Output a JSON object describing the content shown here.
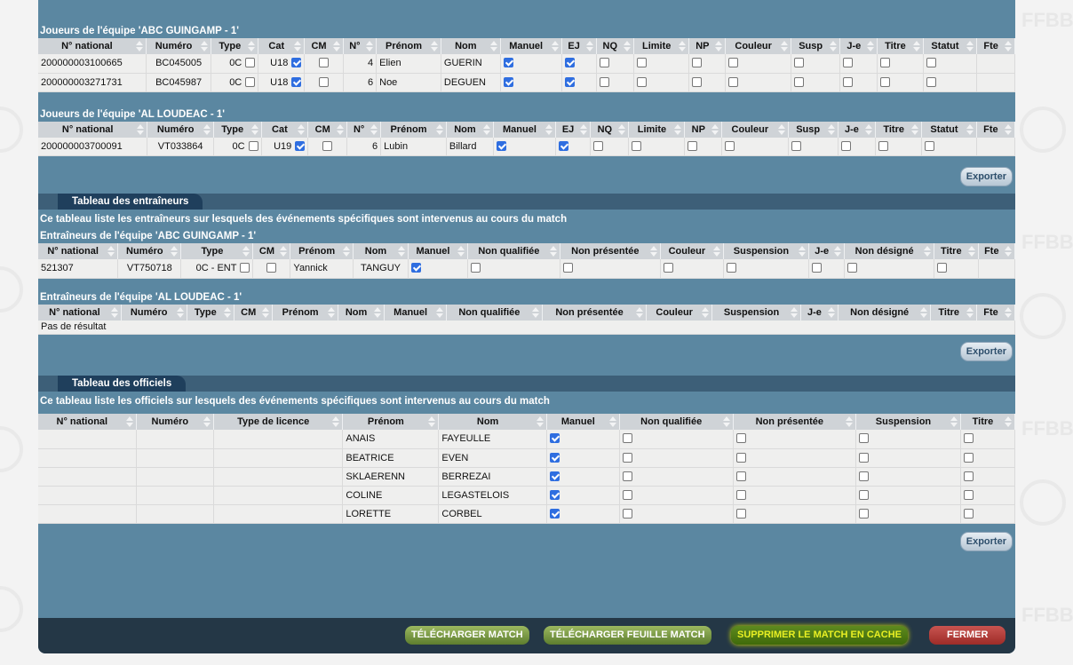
{
  "team_players": [
    {
      "title": "Joueurs de l'équipe 'ABC GUINGAMP - 1'",
      "headers": [
        "N° national",
        "Numéro",
        "Type",
        "Cat",
        "CM",
        "N°",
        "Prénom",
        "Nom",
        "Manuel",
        "EJ",
        "NQ",
        "Limite",
        "NP",
        "Couleur",
        "Susp",
        "J-e",
        "Titre",
        "Statut",
        "Fte"
      ],
      "rows": [
        {
          "national": "200000003100665",
          "numero": "BC045005",
          "type": "0C",
          "cat": "U18",
          "num": "4",
          "prenom": "Elien",
          "nom": "GUERIN"
        },
        {
          "national": "200000003271731",
          "numero": "BC045987",
          "type": "0C",
          "cat": "U18",
          "num": "6",
          "prenom": "Noe",
          "nom": "DEGUEN"
        }
      ]
    },
    {
      "title": "Joueurs de l'équipe 'AL LOUDEAC - 1'",
      "headers": [
        "N° national",
        "Numéro",
        "Type",
        "Cat",
        "CM",
        "N°",
        "Prénom",
        "Nom",
        "Manuel",
        "EJ",
        "NQ",
        "Limite",
        "NP",
        "Couleur",
        "Susp",
        "J-e",
        "Titre",
        "Statut",
        "Fte"
      ],
      "rows": [
        {
          "national": "200000003700091",
          "numero": "VT033864",
          "type": "0C",
          "cat": "U19",
          "num": "6",
          "prenom": "Lubin",
          "nom": "Billard"
        }
      ]
    }
  ],
  "export_label": "Exporter",
  "coaches": {
    "section_title": "Tableau des entraîneurs",
    "description": "Ce tableau liste les entraîneurs sur lesquels des événements spécifiques sont intervenus au cours du match",
    "team1_title": "Entraîneurs de l'équipe 'ABC GUINGAMP - 1'",
    "team1_headers": [
      "N° national",
      "Numéro",
      "Type",
      "CM",
      "Prénom",
      "Nom",
      "Manuel",
      "Non qualifiée",
      "Non présentée",
      "Couleur",
      "Suspension",
      "J-e",
      "Non désigné",
      "Titre",
      "Fte"
    ],
    "team1_row": {
      "national": "521307",
      "numero": "VT750718",
      "type": "0C - ENT",
      "prenom": "Yannick",
      "nom": "TANGUY"
    },
    "team2_title": "Entraîneurs de l'équipe 'AL LOUDEAC - 1'",
    "team2_headers": [
      "N° national",
      "Numéro",
      "Type",
      "CM",
      "Prénom",
      "Nom",
      "Manuel",
      "Non qualifiée",
      "Non présentée",
      "Couleur",
      "Suspension",
      "J-e",
      "Non désigné",
      "Titre",
      "Fte"
    ],
    "no_result": "Pas de résultat"
  },
  "officials": {
    "section_title": "Tableau des officiels",
    "description": "Ce tableau liste les officiels sur lesquels des événements spécifiques sont intervenus au cours du match",
    "headers": [
      "N° national",
      "Numéro",
      "Type de licence",
      "Prénom",
      "Nom",
      "Manuel",
      "Non qualifiée",
      "Non présentée",
      "Suspension",
      "Titre"
    ],
    "rows": [
      {
        "prenom": "ANAIS",
        "nom": "FAYEULLE"
      },
      {
        "prenom": "BEATRICE",
        "nom": "EVEN"
      },
      {
        "prenom": "SKLAERENN",
        "nom": "BERREZAI"
      },
      {
        "prenom": "COLINE",
        "nom": "LEGASTELOIS"
      },
      {
        "prenom": "LORETTE",
        "nom": "CORBEL"
      }
    ]
  },
  "footer": {
    "download_match": "TÉLÉCHARGER MATCH",
    "download_sheet": "TÉLÉCHARGER FEUILLE MATCH",
    "delete_cache": "SUPPRIMER LE MATCH EN CACHE",
    "close": "FERMER"
  },
  "watermark": "FFBB",
  "colors": {
    "panel": "#5b87a1",
    "section_tab": "#1f3f5c",
    "checkbox_on": "#2f6ee0",
    "yellow_text": "#e8ef23",
    "close_red": "#b23b37"
  }
}
